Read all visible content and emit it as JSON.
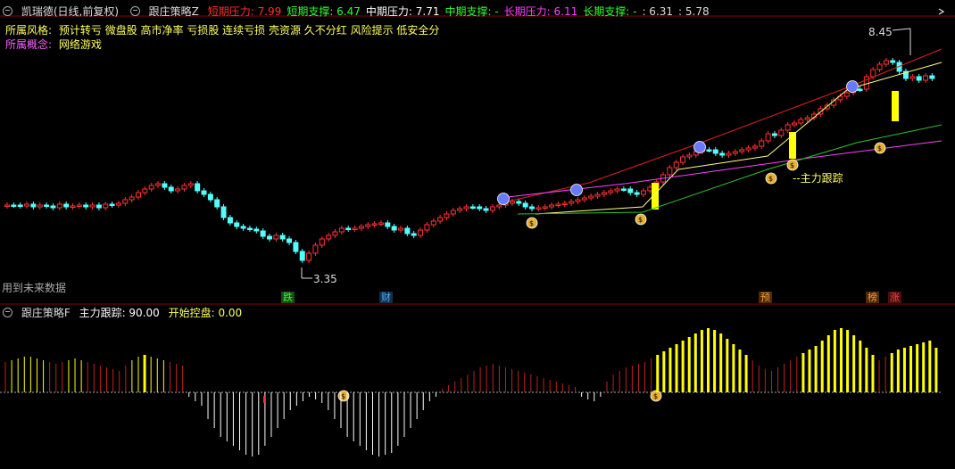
{
  "header": {
    "stock_name": "凯瑞德(日线,前复权)",
    "indicator_name": "跟庄策略Z",
    "items": [
      {
        "label": "短期压力: 7.99",
        "color": "#ff3030"
      },
      {
        "label": "短期支撑: 6.47",
        "color": "#30ff30"
      },
      {
        "label": "中期压力: 7.71",
        "color": "#ffffff"
      },
      {
        "label": "中期支撑: -",
        "color": "#30ff30"
      },
      {
        "label": "长期压力: 6.11",
        "color": "#ff40ff"
      },
      {
        "label": "长期支撑: -",
        "color": "#30ff30"
      },
      {
        "label": ": 6.31",
        "color": "#dddddd"
      },
      {
        "label": ": 5.78",
        "color": "#dddddd"
      }
    ]
  },
  "info": {
    "style_label": "所属风格:",
    "style_value": "预计转亏 微盘股 高市净率 亏损股 连续亏损 壳资源 久不分红 风险提示 低安全分",
    "concept_label": "所属概念:",
    "concept_value": "网络游戏"
  },
  "annotations": {
    "high_price": "8.45",
    "low_price": "3.35",
    "future_data": "用到未来数据",
    "main_tracking": "--主力跟踪"
  },
  "event_tags": [
    {
      "label": "跌",
      "color": "#30ff30",
      "bg": "#1a4a1a"
    },
    {
      "label": "财",
      "color": "#4ab0ff",
      "bg": "#10304a"
    },
    {
      "label": "预",
      "color": "#ff9a30",
      "bg": "#4a2a10"
    },
    {
      "label": "榜",
      "color": "#ff9a30",
      "bg": "#4a2a10"
    },
    {
      "label": "涨",
      "color": "#ff4040",
      "bg": "#4a1010"
    }
  ],
  "sub_header": {
    "indicator_name": "跟庄策略F",
    "main_tracking": "主力跟踪: 90.00",
    "start_control": "开始控盘: 0.00"
  },
  "colors": {
    "up": "#ff3232",
    "down": "#54ffff",
    "yellow": "#ffff00",
    "magenta": "#ff40ff",
    "green": "#30c030",
    "white_line": "#ffff80",
    "red_line": "#e02020"
  },
  "icons": [
    "money-bag-icon",
    "face-icon",
    "chevron-icon",
    "toggle-icon"
  ]
}
